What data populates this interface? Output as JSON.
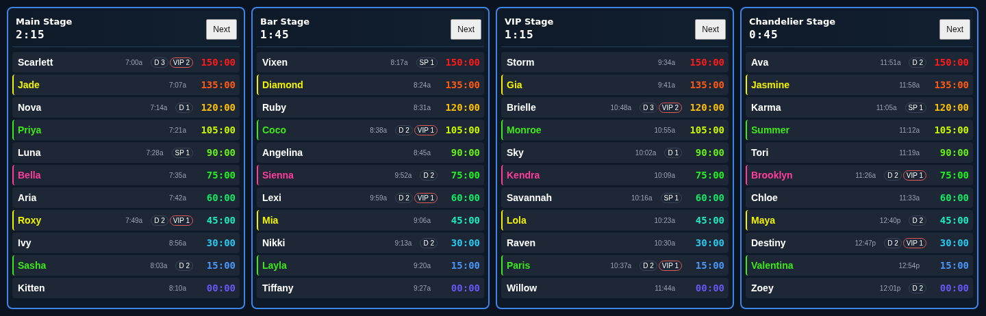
{
  "stages": [
    {
      "title": "Main Stage",
      "clock": "2:15",
      "button": "Next",
      "rows": [
        {
          "name": "Scarlett",
          "time": "7:00a",
          "tags": [
            {
              "kind": "d",
              "text": "D 3"
            },
            {
              "kind": "vip",
              "text": "VIP 2"
            }
          ],
          "timer": {
            "text": "150:00",
            "color": "#ff1a1a"
          }
        },
        {
          "name": "Jade",
          "color": "#f2f200",
          "time": "7:07a",
          "tags": [],
          "timer": {
            "text": "135:00",
            "color": "#ff5a14"
          }
        },
        {
          "name": "Nova",
          "time": "7:14a",
          "tags": [
            {
              "kind": "d",
              "text": "D 1"
            }
          ],
          "timer": {
            "text": "120:00",
            "color": "#ffc000"
          }
        },
        {
          "name": "Priya",
          "color": "#3ee81a",
          "time": "7:21a",
          "tags": [],
          "timer": {
            "text": "105:00",
            "color": "#c8f500"
          }
        },
        {
          "name": "Luna",
          "time": "7:28a",
          "tags": [
            {
              "kind": "sp",
              "text": "SP 1"
            }
          ],
          "timer": {
            "text": "90:00",
            "color": "#66f01a"
          }
        },
        {
          "name": "Bella",
          "color": "#ff3d9a",
          "time": "7:35a",
          "tags": [],
          "timer": {
            "text": "75:00",
            "color": "#22f022"
          }
        },
        {
          "name": "Aria",
          "time": "7:42a",
          "tags": [],
          "timer": {
            "text": "60:00",
            "color": "#14e864"
          }
        },
        {
          "name": "Roxy",
          "color": "#f2f200",
          "time": "7:49a",
          "tags": [
            {
              "kind": "d",
              "text": "D 2"
            },
            {
              "kind": "vip",
              "text": "VIP 1"
            }
          ],
          "timer": {
            "text": "45:00",
            "color": "#1ee8c0"
          }
        },
        {
          "name": "Ivy",
          "time": "8:56a",
          "tags": [],
          "timer": {
            "text": "30:00",
            "color": "#28c8f0"
          }
        },
        {
          "name": "Sasha",
          "color": "#3ee81a",
          "time": "8:03a",
          "tags": [
            {
              "kind": "d",
              "text": "D 2"
            }
          ],
          "timer": {
            "text": "15:00",
            "color": "#4a96f5"
          }
        },
        {
          "name": "Kitten",
          "time": "8:10a",
          "tags": [],
          "timer": {
            "text": "00:00",
            "color": "#6658f5"
          }
        }
      ]
    },
    {
      "title": "Bar Stage",
      "clock": "1:45",
      "button": "Next",
      "rows": [
        {
          "name": "Vixen",
          "time": "8:17a",
          "tags": [
            {
              "kind": "sp",
              "text": "SP 1"
            }
          ],
          "timer": {
            "text": "150:00",
            "color": "#ff1a1a"
          }
        },
        {
          "name": "Diamond",
          "color": "#f2f200",
          "time": "8:24a",
          "tags": [],
          "timer": {
            "text": "135:00",
            "color": "#ff5a14"
          }
        },
        {
          "name": "Ruby",
          "time": "8:31a",
          "tags": [],
          "timer": {
            "text": "120:00",
            "color": "#ffc000"
          }
        },
        {
          "name": "Coco",
          "color": "#3ee81a",
          "time": "8:38a",
          "tags": [
            {
              "kind": "d",
              "text": "D 2"
            },
            {
              "kind": "vip",
              "text": "VIP 1"
            }
          ],
          "timer": {
            "text": "105:00",
            "color": "#c8f500"
          }
        },
        {
          "name": "Angelina",
          "time": "8:45a",
          "tags": [],
          "timer": {
            "text": "90:00",
            "color": "#66f01a"
          }
        },
        {
          "name": "Sienna",
          "color": "#ff3d9a",
          "time": "9:52a",
          "tags": [
            {
              "kind": "d",
              "text": "D 2"
            }
          ],
          "timer": {
            "text": "75:00",
            "color": "#22f022"
          }
        },
        {
          "name": "Lexi",
          "time": "9:59a",
          "tags": [
            {
              "kind": "d",
              "text": "D 2"
            },
            {
              "kind": "vip",
              "text": "VIP 1"
            }
          ],
          "timer": {
            "text": "60:00",
            "color": "#14e864"
          }
        },
        {
          "name": "Mia",
          "color": "#f2f200",
          "time": "9:06a",
          "tags": [],
          "timer": {
            "text": "45:00",
            "color": "#1ee8c0"
          }
        },
        {
          "name": "Nikki",
          "time": "9:13a",
          "tags": [
            {
              "kind": "d",
              "text": "D 2"
            }
          ],
          "timer": {
            "text": "30:00",
            "color": "#28c8f0"
          }
        },
        {
          "name": "Layla",
          "color": "#3ee81a",
          "time": "9:20a",
          "tags": [],
          "timer": {
            "text": "15:00",
            "color": "#4a96f5"
          }
        },
        {
          "name": "Tiffany",
          "time": "9:27a",
          "tags": [],
          "timer": {
            "text": "00:00",
            "color": "#6658f5"
          }
        }
      ]
    },
    {
      "title": "VIP Stage",
      "clock": "1:15",
      "button": "Next",
      "rows": [
        {
          "name": "Storm",
          "time": "9:34a",
          "tags": [],
          "timer": {
            "text": "150:00",
            "color": "#ff1a1a"
          }
        },
        {
          "name": "Gia",
          "color": "#f2f200",
          "time": "9:41a",
          "tags": [],
          "timer": {
            "text": "135:00",
            "color": "#ff5a14"
          }
        },
        {
          "name": "Brielle",
          "time": "10:48a",
          "tags": [
            {
              "kind": "d",
              "text": "D 3"
            },
            {
              "kind": "vip",
              "text": "VIP 2"
            }
          ],
          "timer": {
            "text": "120:00",
            "color": "#ffc000"
          }
        },
        {
          "name": "Monroe",
          "color": "#3ee81a",
          "time": "10:55a",
          "tags": [],
          "timer": {
            "text": "105:00",
            "color": "#c8f500"
          }
        },
        {
          "name": "Sky",
          "time": "10:02a",
          "tags": [
            {
              "kind": "d",
              "text": "D 1"
            }
          ],
          "timer": {
            "text": "90:00",
            "color": "#66f01a"
          }
        },
        {
          "name": "Kendra",
          "color": "#ff3d9a",
          "time": "10:09a",
          "tags": [],
          "timer": {
            "text": "75:00",
            "color": "#22f022"
          }
        },
        {
          "name": "Savannah",
          "time": "10:16a",
          "tags": [
            {
              "kind": "sp",
              "text": "SP 1"
            }
          ],
          "timer": {
            "text": "60:00",
            "color": "#14e864"
          }
        },
        {
          "name": "Lola",
          "color": "#f2f200",
          "time": "10:23a",
          "tags": [],
          "timer": {
            "text": "45:00",
            "color": "#1ee8c0"
          }
        },
        {
          "name": "Raven",
          "time": "10:30a",
          "tags": [],
          "timer": {
            "text": "30:00",
            "color": "#28c8f0"
          }
        },
        {
          "name": "Paris",
          "color": "#3ee81a",
          "time": "10:37a",
          "tags": [
            {
              "kind": "d",
              "text": "D 2"
            },
            {
              "kind": "vip",
              "text": "VIP 1"
            }
          ],
          "timer": {
            "text": "15:00",
            "color": "#4a96f5"
          }
        },
        {
          "name": "Willow",
          "time": "11:44a",
          "tags": [],
          "timer": {
            "text": "00:00",
            "color": "#6658f5"
          }
        }
      ]
    },
    {
      "title": "Chandelier Stage",
      "clock": "0:45",
      "button": "Next",
      "rows": [
        {
          "name": "Ava",
          "time": "11:51a",
          "tags": [
            {
              "kind": "d",
              "text": "D 2"
            }
          ],
          "timer": {
            "text": "150:00",
            "color": "#ff1a1a"
          }
        },
        {
          "name": "Jasmine",
          "color": "#f2f200",
          "time": "11:58a",
          "tags": [],
          "timer": {
            "text": "135:00",
            "color": "#ff5a14"
          }
        },
        {
          "name": "Karma",
          "time": "11:05a",
          "tags": [
            {
              "kind": "sp",
              "text": "SP 1"
            }
          ],
          "timer": {
            "text": "120:00",
            "color": "#ffc000"
          }
        },
        {
          "name": "Summer",
          "color": "#3ee81a",
          "time": "11:12a",
          "tags": [],
          "timer": {
            "text": "105:00",
            "color": "#c8f500"
          }
        },
        {
          "name": "Tori",
          "time": "11:19a",
          "tags": [],
          "timer": {
            "text": "90:00",
            "color": "#66f01a"
          }
        },
        {
          "name": "Brooklyn",
          "color": "#ff3d9a",
          "time": "11:26a",
          "tags": [
            {
              "kind": "d",
              "text": "D 2"
            },
            {
              "kind": "vip",
              "text": "VIP 1"
            }
          ],
          "timer": {
            "text": "75:00",
            "color": "#22f022"
          }
        },
        {
          "name": "Chloe",
          "time": "11:33a",
          "tags": [],
          "timer": {
            "text": "60:00",
            "color": "#14e864"
          }
        },
        {
          "name": "Maya",
          "color": "#f2f200",
          "time": "12:40p",
          "tags": [
            {
              "kind": "d",
              "text": "D 2"
            }
          ],
          "timer": {
            "text": "45:00",
            "color": "#1ee8c0"
          }
        },
        {
          "name": "Destiny",
          "time": "12:47p",
          "tags": [
            {
              "kind": "d",
              "text": "D 2"
            },
            {
              "kind": "vip",
              "text": "VIP 1"
            }
          ],
          "timer": {
            "text": "30:00",
            "color": "#28c8f0"
          }
        },
        {
          "name": "Valentina",
          "color": "#3ee81a",
          "time": "12:54p",
          "tags": [],
          "timer": {
            "text": "15:00",
            "color": "#4a96f5"
          }
        },
        {
          "name": "Zoey",
          "time": "12:01p",
          "tags": [
            {
              "kind": "d",
              "text": "D 2"
            }
          ],
          "timer": {
            "text": "00:00",
            "color": "#6658f5"
          }
        }
      ]
    }
  ]
}
